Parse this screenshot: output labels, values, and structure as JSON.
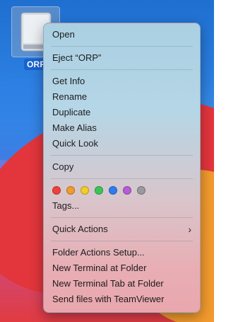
{
  "desktop": {
    "drive_label": "ORP"
  },
  "menu": {
    "open": "Open",
    "eject": "Eject “ORP”",
    "get_info": "Get Info",
    "rename": "Rename",
    "duplicate": "Duplicate",
    "make_alias": "Make Alias",
    "quick_look": "Quick Look",
    "copy": "Copy",
    "tags": "Tags...",
    "quick_actions": "Quick Actions",
    "folder_actions_setup": "Folder Actions Setup...",
    "new_terminal": "New Terminal at Folder",
    "new_terminal_tab": "New Terminal Tab at Folder",
    "send_teamviewer": "Send files with TeamViewer"
  },
  "tag_colors": [
    {
      "name": "red",
      "color": "#f0403c"
    },
    {
      "name": "orange",
      "color": "#f29a2e"
    },
    {
      "name": "yellow",
      "color": "#f5cc29"
    },
    {
      "name": "green",
      "color": "#3cc45a"
    },
    {
      "name": "blue",
      "color": "#2f7cf2"
    },
    {
      "name": "purple",
      "color": "#b65cd6"
    },
    {
      "name": "gray",
      "color": "#9a9a9e"
    }
  ],
  "icons": {
    "drive": "external-drive-icon",
    "submenu": "chevron-right-icon"
  }
}
